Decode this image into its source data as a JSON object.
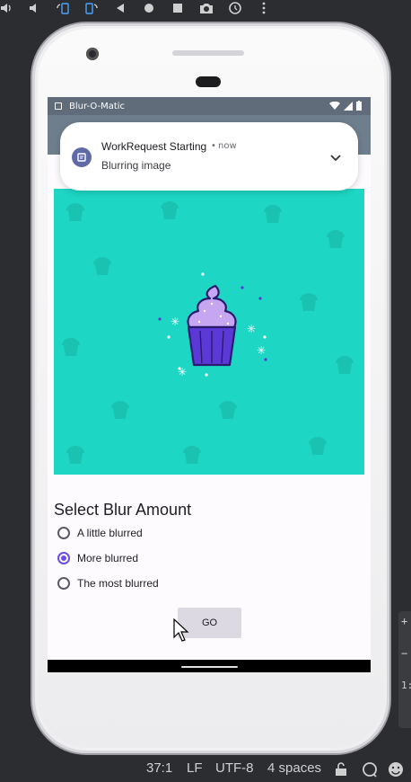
{
  "emulator_toolbar": {
    "icons": [
      "volume-up-icon",
      "volume-down-icon",
      "rotate-left-icon",
      "rotate-right-icon",
      "back-icon",
      "home-icon",
      "overview-icon",
      "camera-icon",
      "rotate-reset-icon",
      "more-icon"
    ]
  },
  "status_bar": {
    "app_name": "Blur-O-Matic"
  },
  "notification": {
    "title": "WorkRequest Starting",
    "separator": "•",
    "time": "now",
    "text": "Blurring image"
  },
  "blur_section": {
    "title": "Select Blur Amount",
    "options": [
      {
        "label": "A little blurred",
        "checked": false
      },
      {
        "label": "More blurred",
        "checked": true
      },
      {
        "label": "The most blurred",
        "checked": false
      }
    ]
  },
  "go_button": {
    "label": "GO"
  },
  "ide_status": {
    "position": "37:1",
    "line_ending": "LF",
    "encoding": "UTF-8",
    "indent": "4 spaces"
  },
  "ide_edge": {
    "plus": "+",
    "minus": "−",
    "ratio": "1:"
  },
  "colors": {
    "image_background": "#1ed6c4",
    "accent": "#6a4ee8",
    "status_bar": "#606c79",
    "app_bar": "#6f7e8d",
    "cupcake_frosting": "#c6a6f0",
    "cupcake_wrapper": "#5a39d6"
  }
}
